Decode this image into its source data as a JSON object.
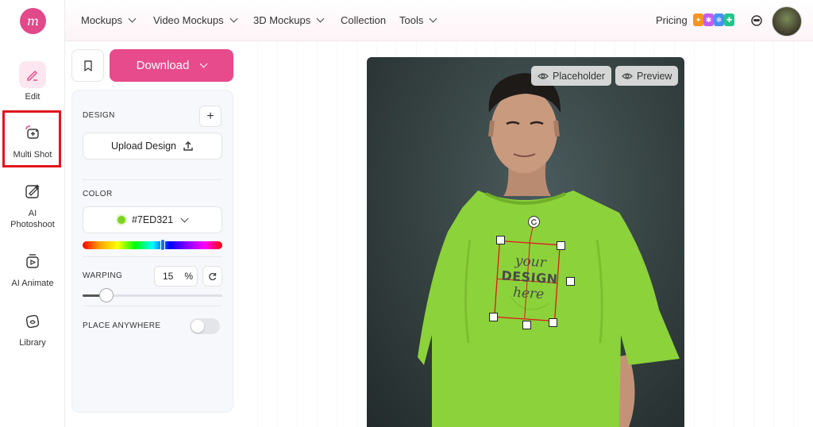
{
  "app": {
    "logo_text": "m"
  },
  "rail": {
    "items": [
      {
        "label": "Edit",
        "icon": "pencil-icon"
      },
      {
        "label": "Multi Shot",
        "icon": "multi-shot-icon"
      },
      {
        "label": "AI\nPhotoshoot",
        "icon": "photoshoot-icon"
      },
      {
        "label": "AI Animate",
        "icon": "animate-icon"
      },
      {
        "label": "Library",
        "icon": "library-icon"
      }
    ],
    "highlighted": "Multi Shot"
  },
  "nav": {
    "items": [
      {
        "label": "Mockups",
        "has_dropdown": true
      },
      {
        "label": "Video Mockups",
        "has_dropdown": true
      },
      {
        "label": "3D Mockups",
        "has_dropdown": true
      },
      {
        "label": "Collection",
        "has_dropdown": false
      },
      {
        "label": "Tools",
        "has_dropdown": true
      }
    ],
    "pricing_label": "Pricing",
    "pricing_badge_colors": [
      "#f7941d",
      "#c45cf2",
      "#4a8ff5",
      "#22c58b"
    ]
  },
  "toolbar": {
    "download_label": "Download"
  },
  "panel": {
    "design_label": "DESIGN",
    "upload_label": "Upload Design",
    "color_label": "COLOR",
    "color_value": "#7ED321",
    "hue_position_pct": 61,
    "warping_label": "WARPING",
    "warping_value": "15",
    "warping_unit": "%",
    "warping_slider_pct": 15,
    "place_anywhere_label": "PLACE ANYWHERE",
    "place_anywhere_on": false
  },
  "canvas": {
    "placeholder_label": "Placeholder",
    "preview_label": "Preview",
    "design_text": {
      "line1": "your",
      "line2": "DESIGN",
      "line3": "here"
    },
    "shirt_color": "#8cd23a",
    "accent_color": "#e74b8c",
    "selection_color": "#e0161d"
  }
}
